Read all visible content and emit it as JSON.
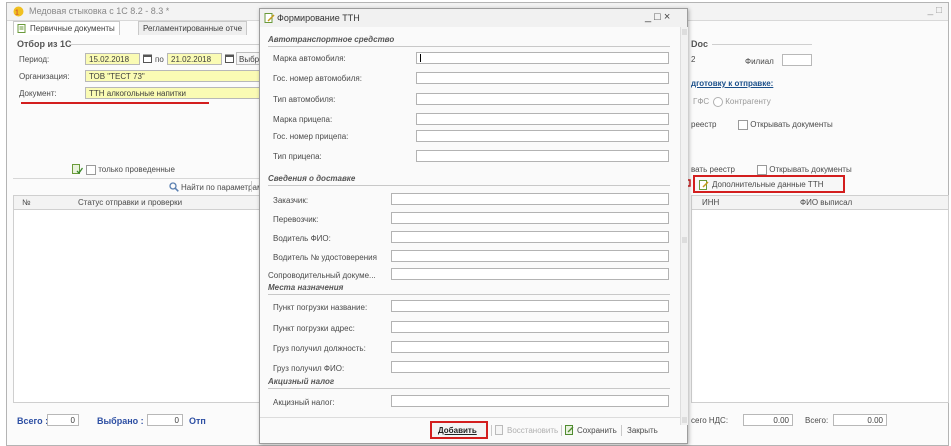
{
  "window": {
    "title": "Медовая стыковка с 1С 8.2 - 8.3 *",
    "controls": "_ □"
  },
  "tabs": [
    {
      "label": "Первичные документы"
    },
    {
      "label": "Регламентированные отче"
    }
  ],
  "filter": {
    "group_title": "Отбор из 1С",
    "period_label": "Период:",
    "period_from": "15.02.2018",
    "period_to_label": "по",
    "period_to": "21.02.2018",
    "choose_button": "Выбрат",
    "org_label": "Организация:",
    "org_value": "ТОВ \"ТЕСТ 73\"",
    "doc_label": "Документ:",
    "doc_value": "ТТН алкогольные напитки"
  },
  "left_list": {
    "only_posted": "только проведенные",
    "find_button": "Найти по параметрам",
    "col_no": "№",
    "col_status": "Статус отправки и проверки"
  },
  "right_panel": {
    "group_title": "Doc",
    "field_value": "2",
    "branch_label": "Филиал",
    "prepare_link": "дготовку к отправке:",
    "radio_gfs": "ГФС",
    "radio_contractor": "Контрагенту",
    "registry_label": "реестр",
    "open_docs": "Открывать документы",
    "registry_label2": "вать реестр",
    "open_docs2": "Открывать документы",
    "extra_button": "Дополнительные данные ТТН",
    "col_inn": "ИНН",
    "col_fio": "ФИО выписал"
  },
  "totals": {
    "total_label": "Всего :",
    "total_value": "0",
    "selected_label": "Выбрано :",
    "selected_value": "0",
    "sent_label": "Отп",
    "vat_label": "сего НДС:",
    "vat_value": "0.00",
    "all_label": "Всего:",
    "all_value": "0.00"
  },
  "dialog": {
    "title": "Формирование ТТН",
    "controls": "_ □ ×",
    "sections": {
      "vehicle": "Автотранспортное средство",
      "delivery": "Сведения о доставке",
      "destination": "Места назначения",
      "excise": "Акцизный налог"
    },
    "vehicle_fields": [
      {
        "label": "Марка автомобиля:"
      },
      {
        "label": "Гос. номер автомобиля:"
      },
      {
        "label": "Тип автомобиля:"
      },
      {
        "label": "Марка прицепа:"
      },
      {
        "label": "Гос. номер прицепа:"
      },
      {
        "label": "Тип прицепа:"
      }
    ],
    "delivery_fields": [
      {
        "label": "Заказчик:"
      },
      {
        "label": "Перевозчик:"
      },
      {
        "label": "Водитель ФИО:"
      },
      {
        "label": "Водитель № удостоверения"
      },
      {
        "label": "Сопроводительный докуме..."
      }
    ],
    "destination_fields": [
      {
        "label": "Пункт погрузки название:"
      },
      {
        "label": "Пункт погрузки адрес:"
      },
      {
        "label": "Груз получил должность:"
      },
      {
        "label": "Груз получил ФИО:"
      }
    ],
    "excise_fields": [
      {
        "label": "Акцизный налог:"
      }
    ],
    "buttons": {
      "add": "Добавить",
      "restore": "Восстановить",
      "save": "Сохранить",
      "close": "Закрыть"
    }
  },
  "colors": {
    "highlight_red": "#d31e1e",
    "field_yellow": "#fafbb4",
    "link_blue": "#1a4f8a"
  }
}
